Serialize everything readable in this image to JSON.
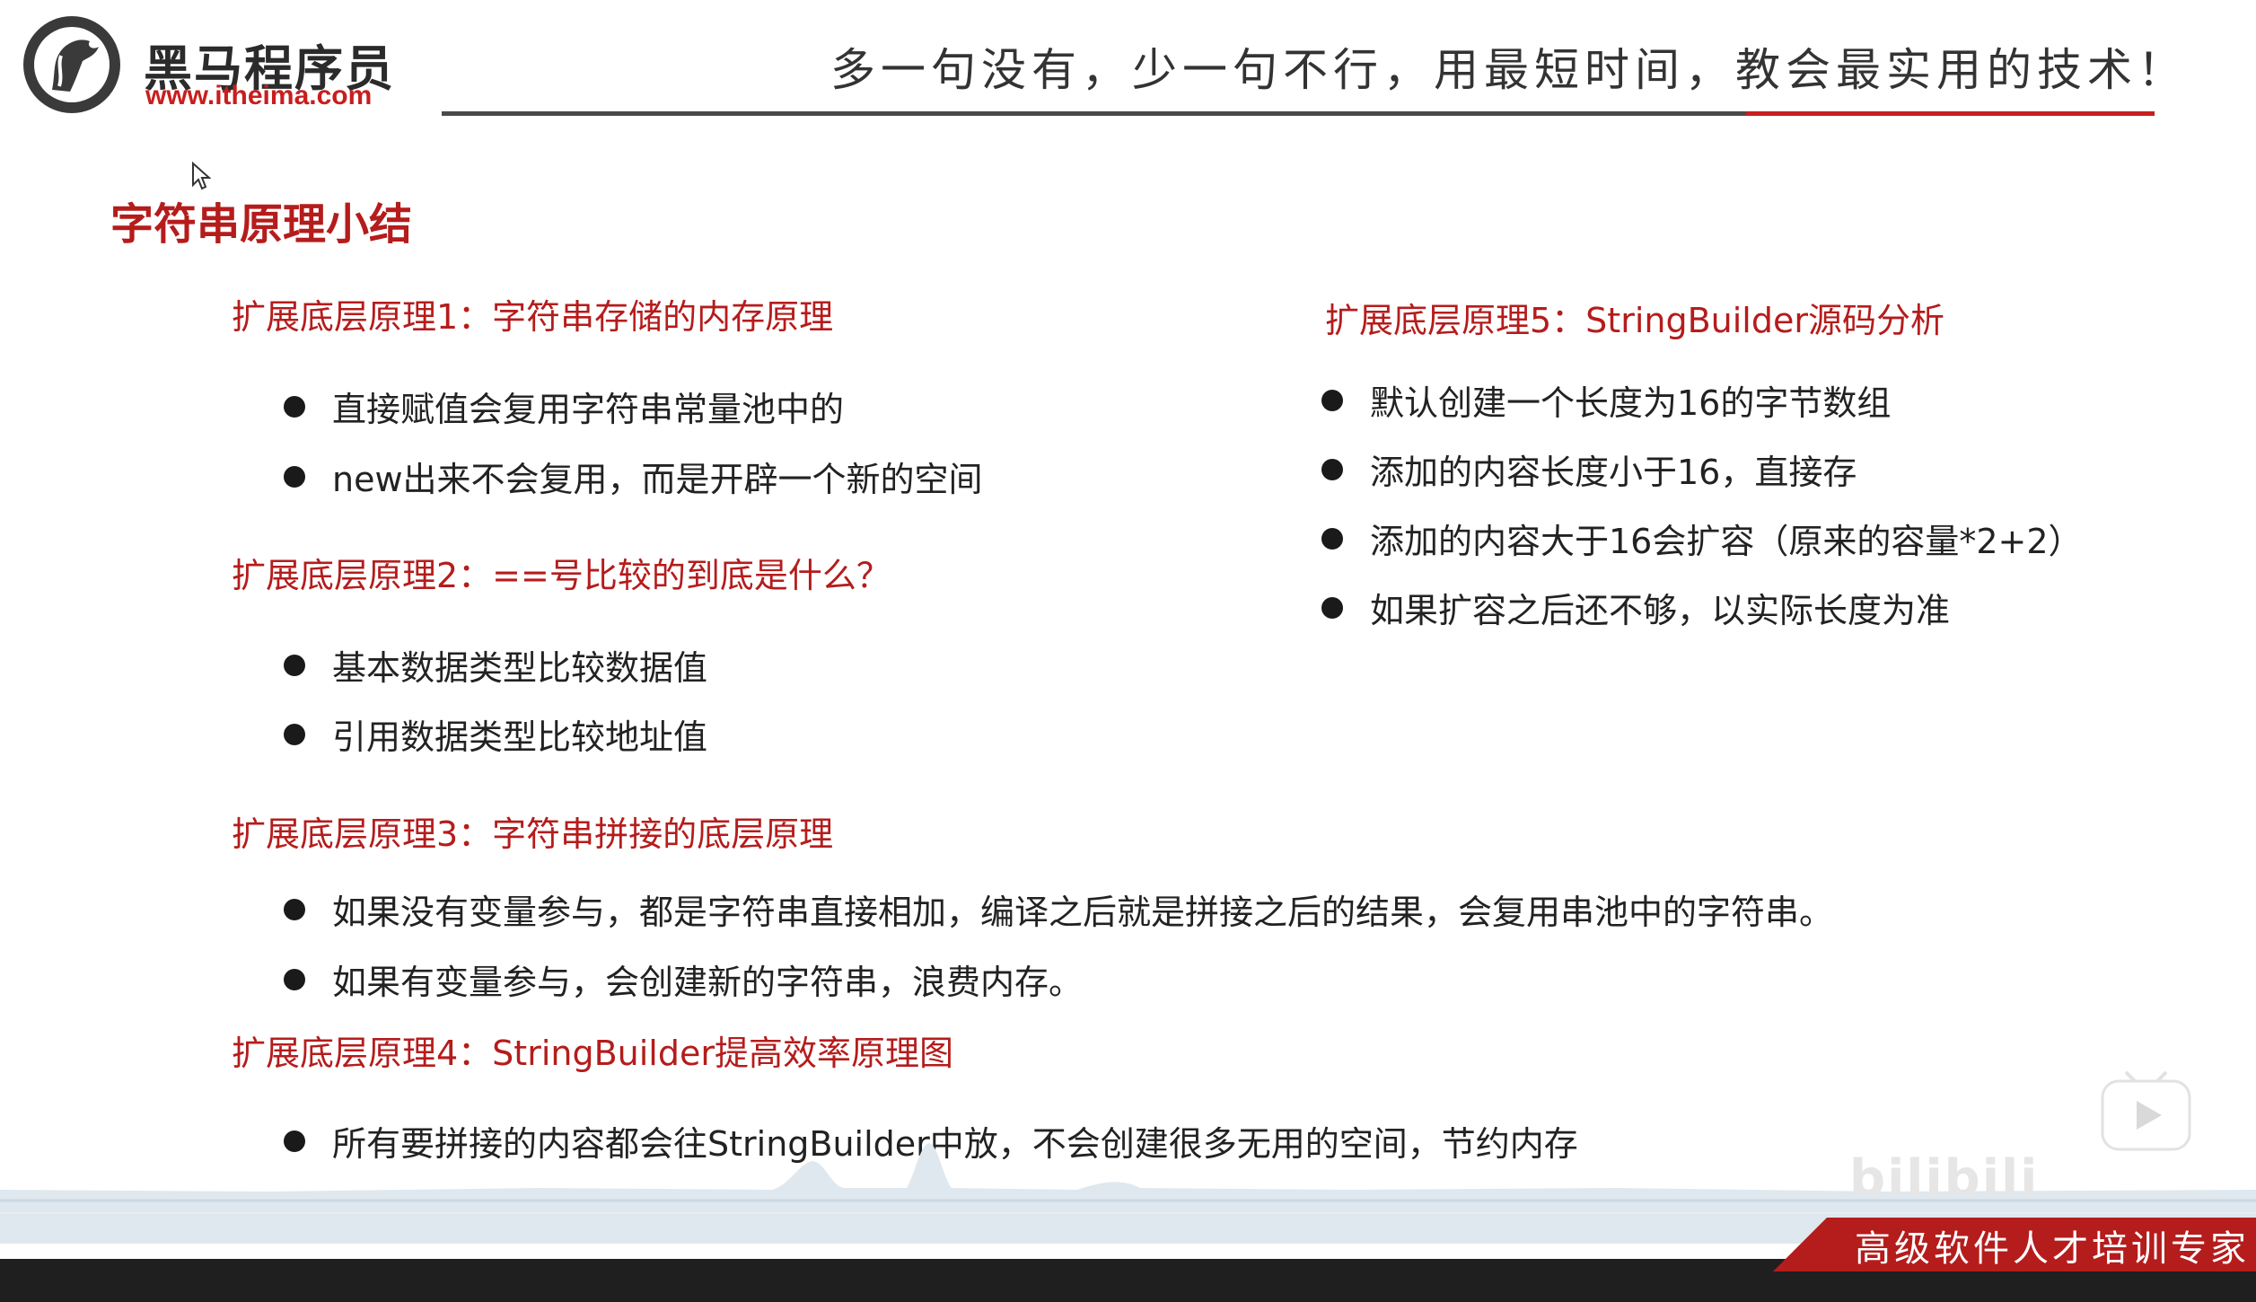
{
  "header": {
    "brand_name": "黑马程序员",
    "brand_url": "www.itheima.com",
    "slogan": "多一句没有，少一句不行，用最短时间，教会最实用的技术！",
    "logo_icon": "horse-head-logo-icon"
  },
  "title": "字符串原理小结",
  "sections": [
    {
      "heading": "扩展底层原理1：字符串存储的内存原理",
      "bullets": [
        "直接赋值会复用字符串常量池中的",
        "new出来不会复用，而是开辟一个新的空间"
      ]
    },
    {
      "heading": "扩展底层原理2：==号比较的到底是什么？",
      "bullets": [
        "基本数据类型比较数据值",
        "引用数据类型比较地址值"
      ]
    },
    {
      "heading": "扩展底层原理3：字符串拼接的底层原理",
      "bullets": [
        "如果没有变量参与，都是字符串直接相加，编译之后就是拼接之后的结果，会复用串池中的字符串。",
        "如果有变量参与，会创建新的字符串，浪费内存。"
      ]
    },
    {
      "heading": "扩展底层原理4：StringBuilder提高效率原理图",
      "bullets": [
        "所有要拼接的内容都会往StringBuilder中放，不会创建很多无用的空间，节约内存"
      ]
    },
    {
      "heading": "扩展底层原理5：StringBuilder源码分析",
      "bullets": [
        "默认创建一个长度为16的字节数组",
        "添加的内容长度小于16，直接存",
        "添加的内容大于16会扩容（原来的容量*2+2）",
        "如果扩容之后还不够，以实际长度为准"
      ]
    }
  ],
  "footer": {
    "tagline": "高级软件人才培训专家"
  },
  "colors": {
    "accent_red": "#b51c1c",
    "brand_red": "#c81e1e",
    "text_dark": "#222222",
    "footer_dark": "#1f1f1f"
  }
}
